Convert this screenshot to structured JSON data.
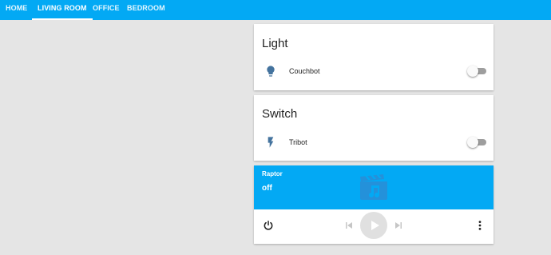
{
  "tabs": [
    {
      "label": "HOME",
      "active": false
    },
    {
      "label": "LIVING ROOM",
      "active": true
    },
    {
      "label": "OFFICE",
      "active": false
    },
    {
      "label": "BEDROOM",
      "active": false
    }
  ],
  "light_card": {
    "title": "Light",
    "entity": {
      "name": "Couchbot",
      "icon": "lightbulb-icon",
      "state": "off"
    }
  },
  "switch_card": {
    "title": "Switch",
    "entity": {
      "name": "Tribot",
      "icon": "flash-icon",
      "state": "off"
    }
  },
  "media_card": {
    "name": "Raptor",
    "state": "off",
    "art_icon": "movie-music-icon",
    "controls": [
      "power-icon",
      "skip-previous-icon",
      "play-icon",
      "skip-next-icon",
      "more-vertical-icon"
    ]
  },
  "colors": {
    "primary": "#03a9f4",
    "background": "#e5e5e5",
    "icon_blue": "#44739e"
  }
}
